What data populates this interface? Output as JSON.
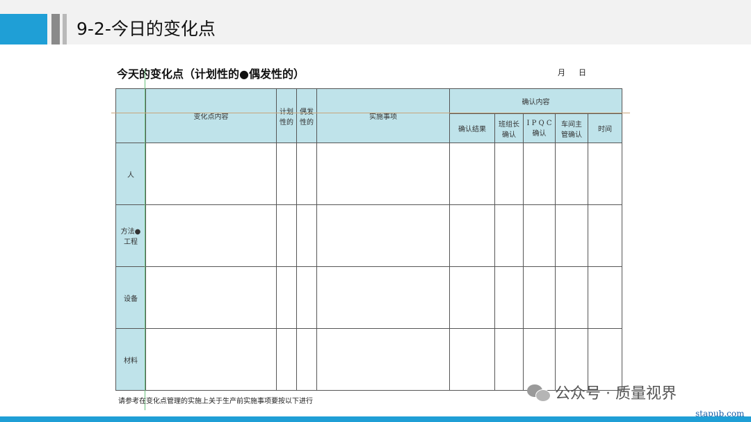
{
  "header": {
    "title": "9-2-今日的变化点"
  },
  "document": {
    "title": "今天的变化点（计划性的●偶发性的）",
    "month_label": "月",
    "day_label": "日",
    "footnote": "请参考在变化点管理的实施上关于生产前实施事项要按以下进行"
  },
  "table": {
    "col_change_content": "变化点内容",
    "col_planned": "计划\n性的",
    "col_accidental": "偶发\n性的",
    "col_actions": "实施事项",
    "col_confirm_group": "确认内容",
    "col_confirm_result": "确认结果",
    "col_team_leader": "班组长\n确认",
    "col_ipqc": "I P Q C\n确认",
    "col_workshop_head": "车间主\n管确认",
    "col_time": "时间",
    "rows": [
      {
        "category": "人"
      },
      {
        "category": "方法●\n工程"
      },
      {
        "category": "设备"
      },
      {
        "category": "材料"
      }
    ]
  },
  "watermark": {
    "text": "公众号 · 质量视界",
    "site": "stapub.com"
  }
}
